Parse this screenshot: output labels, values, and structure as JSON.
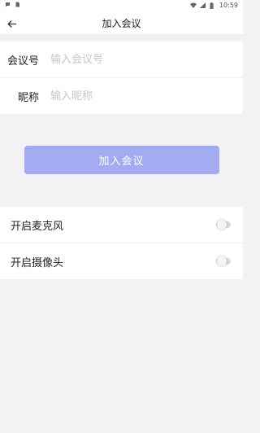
{
  "status_bar": {
    "time": "10:59",
    "left_icons": [
      "notification-icon",
      "sd-card-icon"
    ],
    "right_icons": [
      "wifi-icon",
      "signal-icon",
      "battery-icon"
    ]
  },
  "app_bar": {
    "title": "加入会议",
    "back_icon": "arrow-left-icon"
  },
  "form": {
    "meeting_id": {
      "label": "会议号",
      "value": "",
      "placeholder": "输入会议号"
    },
    "nickname": {
      "label": "昵称",
      "value": "",
      "placeholder": "输入昵称"
    }
  },
  "join_button": {
    "label": "加入会议",
    "color": "#a3acf2"
  },
  "toggles": [
    {
      "label": "开启麦克风",
      "on": false
    },
    {
      "label": "开启摄像头",
      "on": false
    }
  ],
  "colors": {
    "background": "#f2f2f5",
    "surface": "#ffffff",
    "accent": "#a3acf2"
  }
}
